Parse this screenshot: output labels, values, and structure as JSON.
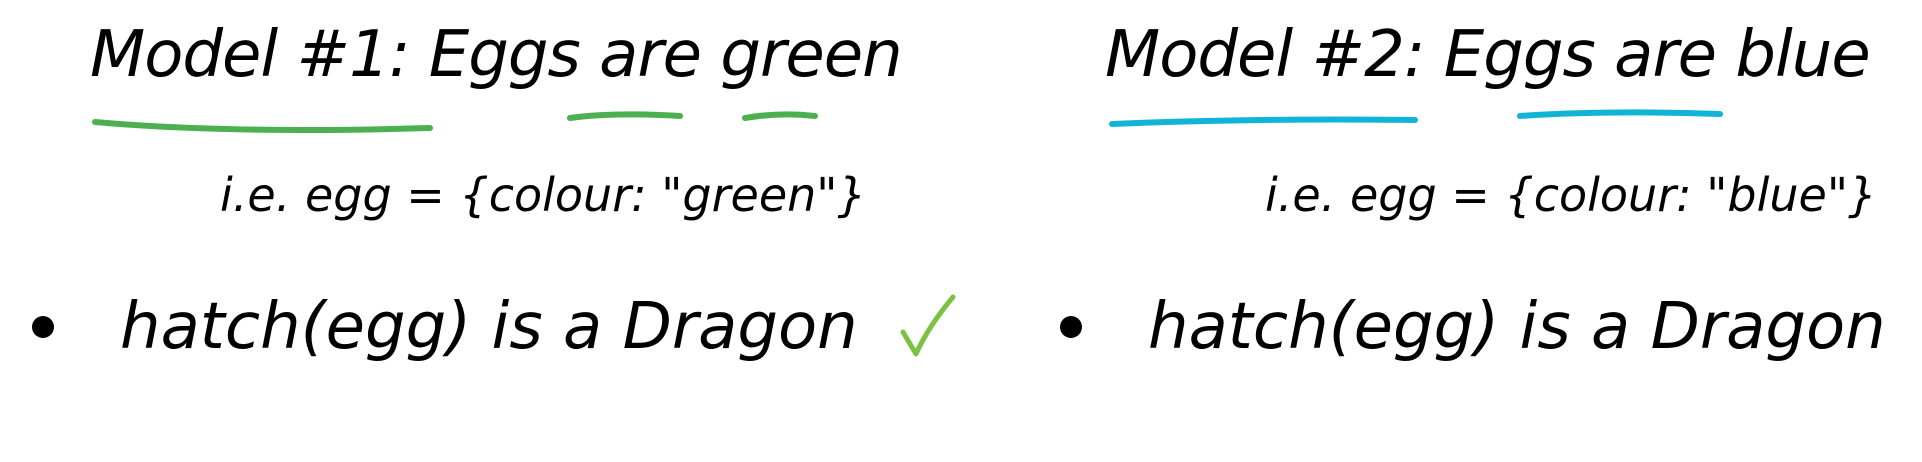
{
  "model1": {
    "title": "Model #1: Eggs are green",
    "formula": "i.e. egg = {colour: \"green\"}",
    "bullet": "hatch(egg) is a Dragon",
    "accent": "#4caf50",
    "check_color": "#7cc242"
  },
  "model2": {
    "title": "Model #2: Eggs are blue",
    "formula": "i.e. egg = {colour: \"blue\"}",
    "bullet": "hatch(egg) is a Dragon",
    "accent": "#12b4d6",
    "check_color": "#7cc242"
  }
}
